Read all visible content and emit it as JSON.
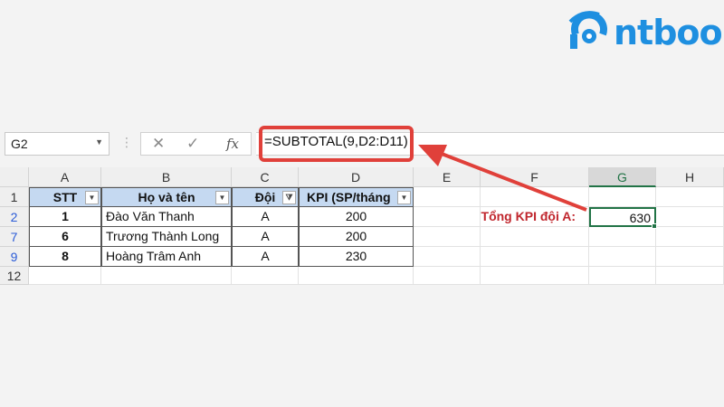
{
  "logo": {
    "text": "ntbook"
  },
  "formula_bar": {
    "name_box": "G2",
    "cancel_icon": "✕",
    "enter_icon": "✓",
    "fx_label": "fx",
    "formula": "=SUBTOTAL(9,D2:D11)"
  },
  "columns": [
    "A",
    "B",
    "C",
    "D",
    "E",
    "F",
    "G",
    "H"
  ],
  "rows": [
    "1",
    "2",
    "7",
    "9",
    "12"
  ],
  "table": {
    "headers": [
      "STT",
      "Họ và tên",
      "Đội",
      "KPI (SP/tháng"
    ],
    "data": [
      [
        "1",
        "Đào Văn Thanh",
        "A",
        "200"
      ],
      [
        "6",
        "Trương Thành Long",
        "A",
        "200"
      ],
      [
        "8",
        "Hoàng Trâm Anh",
        "A",
        "230"
      ]
    ]
  },
  "summary": {
    "label": "Tổng KPI đội A:",
    "value": "630"
  },
  "colors": {
    "accent": "#217346",
    "highlight": "#e0403a",
    "header_fill": "#c5d9f1",
    "logo": "#1e8fe0"
  }
}
